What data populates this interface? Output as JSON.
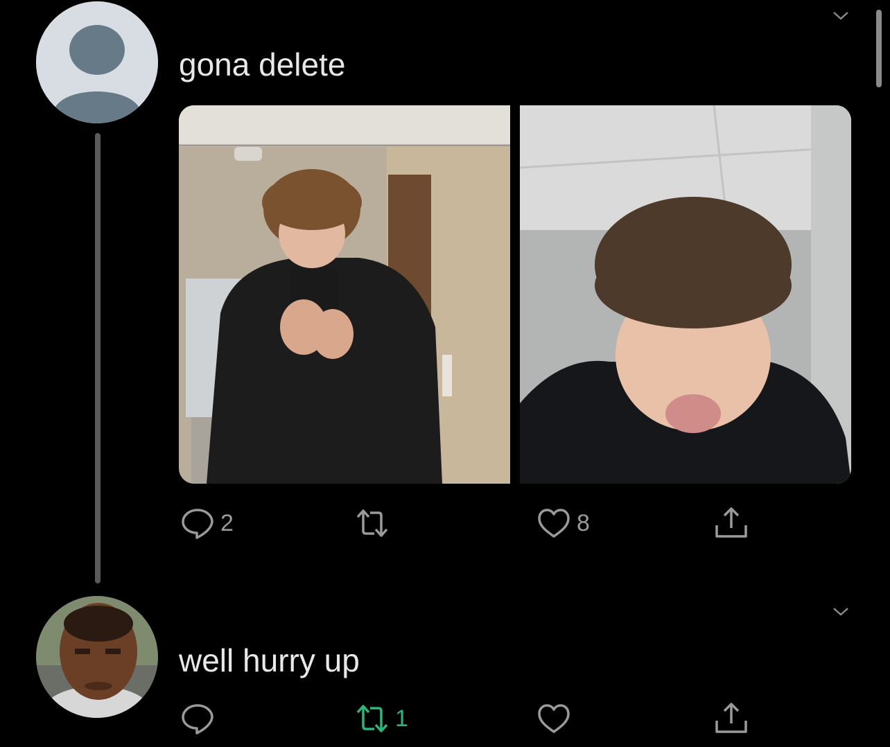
{
  "tweet1": {
    "text": "gona delete",
    "reply_count": "2",
    "retweet_count": "",
    "like_count": "8"
  },
  "tweet2": {
    "text": "well hurry up",
    "reply_count": "",
    "retweet_count": "1",
    "like_count": ""
  },
  "colors": {
    "background": "#000000",
    "text": "#e8e8e8",
    "icon": "#9a9a9a",
    "retweet_active": "#2cb67d"
  }
}
